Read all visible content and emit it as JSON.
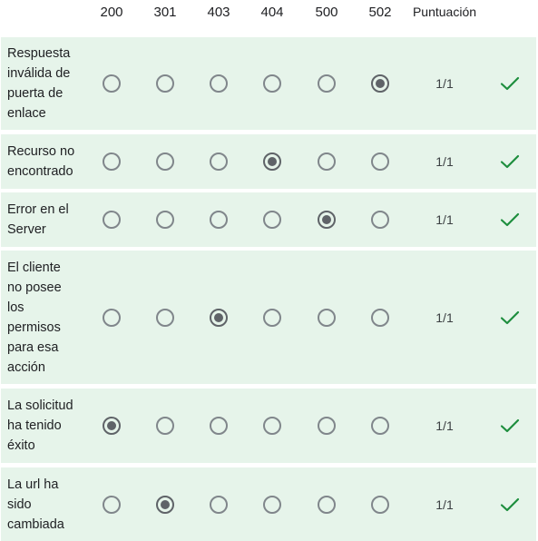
{
  "columns": [
    "200",
    "301",
    "403",
    "404",
    "500",
    "502"
  ],
  "score_header": "Puntuación",
  "rows": [
    {
      "label": "Respuesta\ninválida de\npuerta de\nenlace",
      "selected": 5,
      "score": "1/1",
      "result_icon": "checkmark-icon"
    },
    {
      "label": "Recurso no\nencontrado",
      "selected": 3,
      "score": "1/1",
      "result_icon": "checkmark-icon"
    },
    {
      "label": "Error en el\nServer",
      "selected": 4,
      "score": "1/1",
      "result_icon": "checkmark-icon"
    },
    {
      "label": "El cliente\nno posee\nlos\npermisos\npara esa\nacción",
      "selected": 2,
      "score": "1/1",
      "result_icon": "checkmark-icon"
    },
    {
      "label": "La solicitud\nha tenido\néxito",
      "selected": 0,
      "score": "1/1",
      "result_icon": "checkmark-icon"
    },
    {
      "label": "La url ha\nsido\ncambiada",
      "selected": 1,
      "score": "1/1",
      "result_icon": "checkmark-icon"
    }
  ],
  "colors": {
    "row_background": "#e6f4ea",
    "check_color": "#1e8e3e",
    "radio_border": "#80868b"
  }
}
